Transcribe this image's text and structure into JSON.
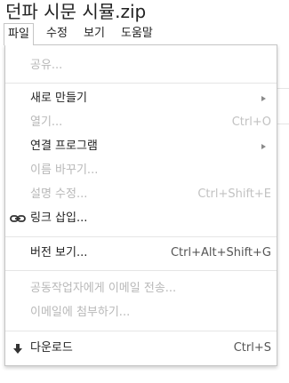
{
  "document": {
    "title": "던파 시문 시뮬.zip"
  },
  "menubar": {
    "file": "파일",
    "edit": "수정",
    "view": "보기",
    "help": "도움말"
  },
  "file_menu": {
    "share": "공유...",
    "new": "새로 만들기",
    "open": "열기...",
    "open_shortcut": "Ctrl+O",
    "open_with": "연결 프로그램",
    "rename": "이름 바꾸기...",
    "edit_description": "설명 수정...",
    "edit_description_shortcut": "Ctrl+Shift+E",
    "insert_link": "링크 삽입...",
    "versions": "버전 보기...",
    "versions_shortcut": "Ctrl+Alt+Shift+G",
    "email_collaborators": "공동작업자에게 이메일 전송...",
    "email_attachment": "이메일에 첨부하기...",
    "download": "다운로드",
    "download_shortcut": "Ctrl+S",
    "icons": {
      "insert_link": "link-icon",
      "download": "download-arrow-icon",
      "submenu": "submenu-arrow-icon"
    }
  }
}
